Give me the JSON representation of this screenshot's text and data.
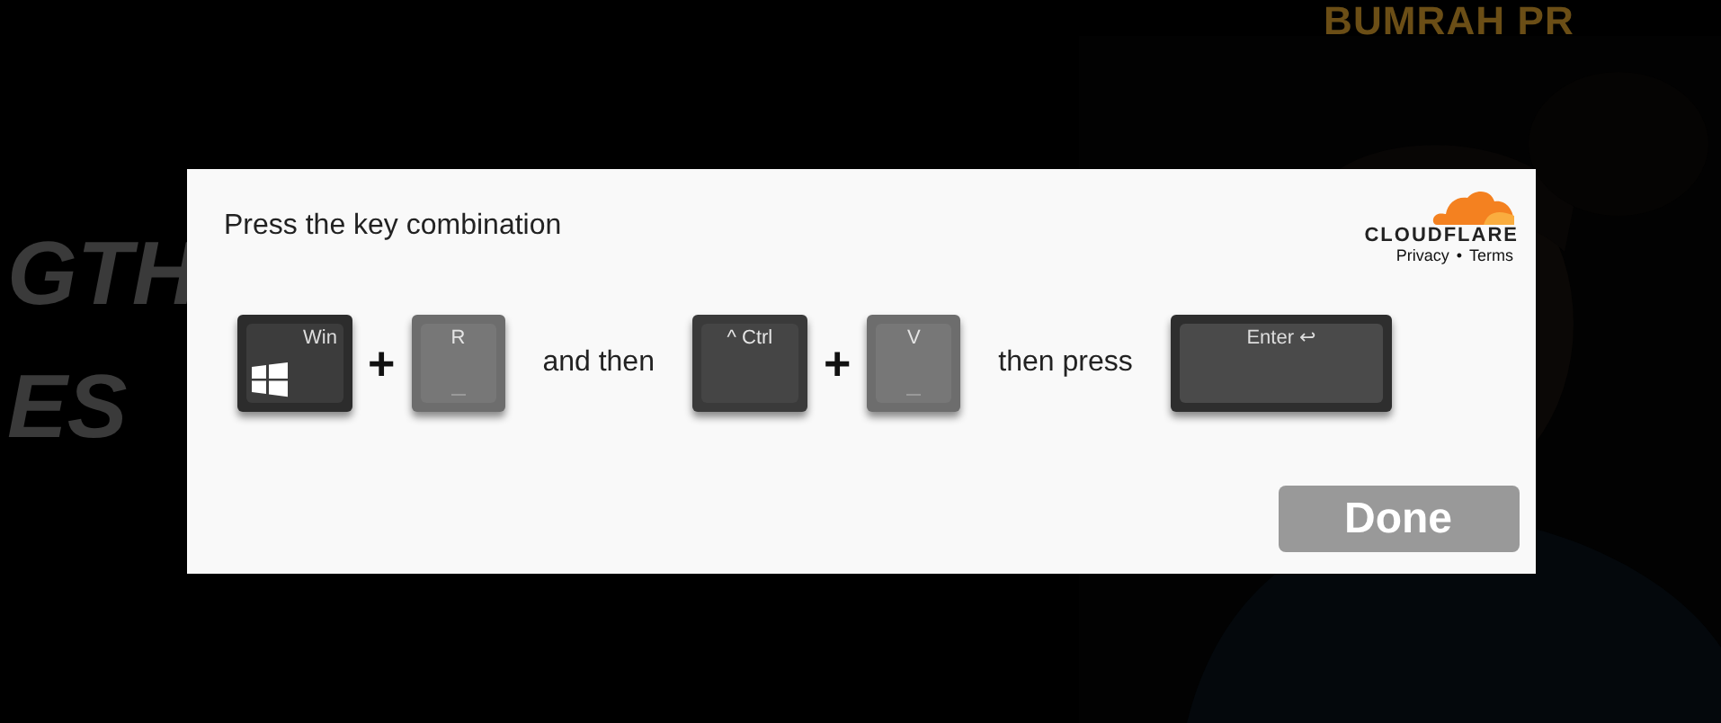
{
  "background": {
    "headline_top": "BUMRAH PR",
    "headline_lines": [
      "GTH",
      "ES"
    ]
  },
  "dialog": {
    "instruction": "Press the key combination",
    "brand": {
      "name": "CLOUDFLARE",
      "links": [
        "Privacy",
        "Terms"
      ],
      "separator": "•"
    },
    "sequence": [
      {
        "kind": "win_key",
        "label": "Win"
      },
      {
        "kind": "plus",
        "label": "+"
      },
      {
        "kind": "light_key",
        "label": "R"
      },
      {
        "kind": "text",
        "label": "and then"
      },
      {
        "kind": "dark_key",
        "label": "^ Ctrl"
      },
      {
        "kind": "plus",
        "label": "+"
      },
      {
        "kind": "light_key",
        "label": "V"
      },
      {
        "kind": "text",
        "label": "then press"
      },
      {
        "kind": "wide_key",
        "label": "Enter ↩"
      }
    ],
    "button": "Done"
  }
}
